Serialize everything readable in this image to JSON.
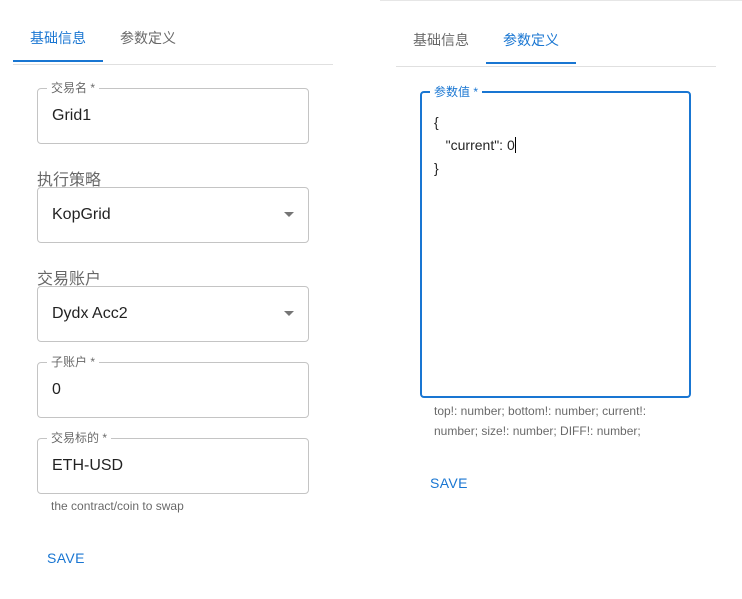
{
  "left": {
    "tabs": [
      {
        "label": "基础信息",
        "active": true
      },
      {
        "label": "参数定义",
        "active": false
      }
    ],
    "fields": {
      "trade_name": {
        "label": "交易名 *",
        "value": "Grid1"
      },
      "strategy": {
        "label": "执行策略",
        "value": "KopGrid"
      },
      "account": {
        "label": "交易账户",
        "value": "Dydx Acc2"
      },
      "subaccount": {
        "label": "子账户 *",
        "value": "0"
      },
      "symbol": {
        "label": "交易标的 *",
        "value": "ETH-USD",
        "helper": "the contract/coin to swap"
      }
    },
    "save_label": "SAVE"
  },
  "right": {
    "tabs": [
      {
        "label": "基础信息",
        "active": false
      },
      {
        "label": "参数定义",
        "active": true
      }
    ],
    "params": {
      "label": "参数值 *",
      "line1": "{",
      "line2": "   \"current\": 0",
      "line3": "}",
      "helper_line1": "top!: number; bottom!: number; current!:",
      "helper_line2": "number; size!: number; DIFF!: number;"
    },
    "save_label": "SAVE"
  },
  "colors": {
    "accent": "#1976d2"
  }
}
